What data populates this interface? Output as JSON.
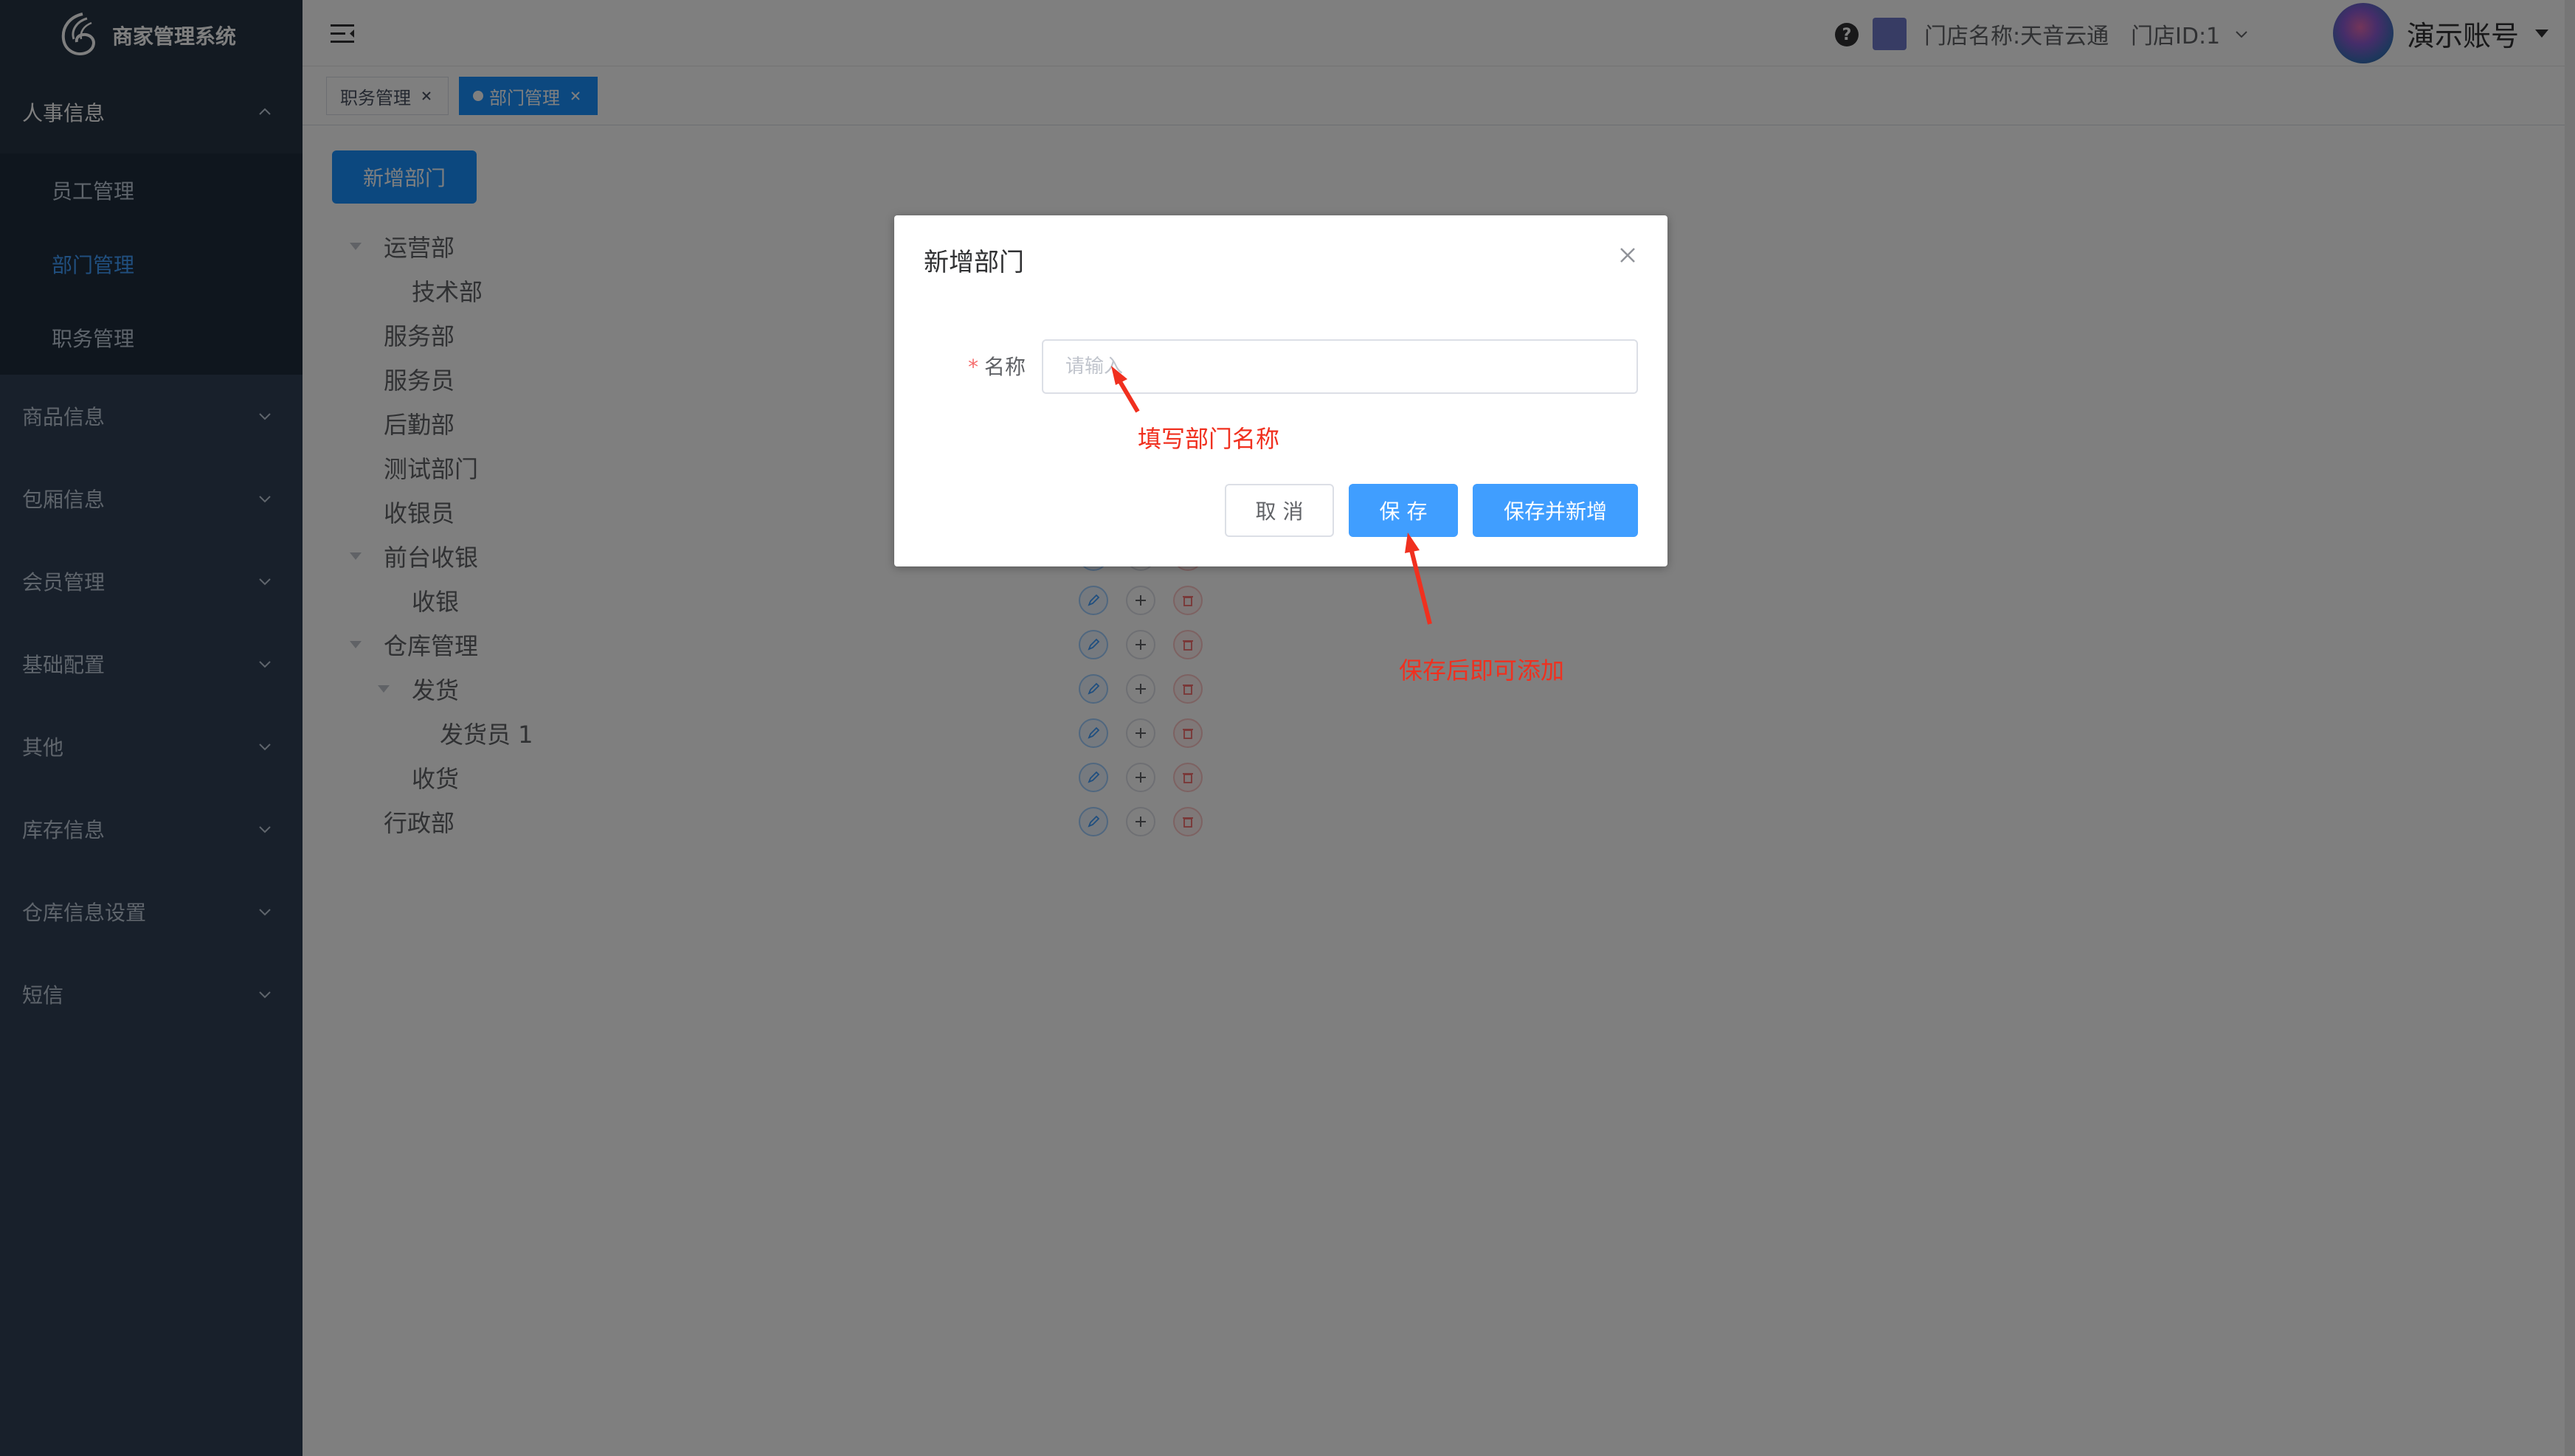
{
  "app": {
    "title": "商家管理系统"
  },
  "sidebar": {
    "groups": [
      {
        "label": "人事信息",
        "open": true
      },
      {
        "label": "商品信息"
      },
      {
        "label": "包厢信息"
      },
      {
        "label": "会员管理"
      },
      {
        "label": "基础配置"
      },
      {
        "label": "其他"
      },
      {
        "label": "库存信息"
      },
      {
        "label": "仓库信息设置"
      },
      {
        "label": "短信"
      }
    ],
    "submenu": [
      {
        "label": "员工管理"
      },
      {
        "label": "部门管理",
        "active": true
      },
      {
        "label": "职务管理"
      }
    ]
  },
  "header": {
    "store_name": "门店名称:天音云通",
    "store_id": "门店ID:1",
    "account": "演示账号"
  },
  "tags": [
    {
      "label": "职务管理"
    },
    {
      "label": "部门管理",
      "active": true
    }
  ],
  "main": {
    "add_button": "新增部门",
    "tree": [
      {
        "label": "运营部",
        "level": 0,
        "expanded": true
      },
      {
        "label": "技术部",
        "level": 1
      },
      {
        "label": "服务部",
        "level": 0
      },
      {
        "label": "服务员",
        "level": 0
      },
      {
        "label": "后勤部",
        "level": 0
      },
      {
        "label": "测试部门",
        "level": 0
      },
      {
        "label": "收银员",
        "level": 0
      },
      {
        "label": "前台收银",
        "level": 0,
        "expanded": true
      },
      {
        "label": "收银",
        "level": 1
      },
      {
        "label": "仓库管理",
        "level": 0,
        "expanded": true
      },
      {
        "label": "发货",
        "level": 1,
        "expanded": true
      },
      {
        "label": "发货员 1",
        "level": 2
      },
      {
        "label": "收货",
        "level": 1
      },
      {
        "label": "行政部",
        "level": 0
      }
    ]
  },
  "dialog": {
    "title": "新增部门",
    "field_label": "名称",
    "field_value": "",
    "field_placeholder": "请输入",
    "cancel": "取 消",
    "save": "保 存",
    "save_and_add": "保存并新增"
  },
  "annotations": {
    "name_hint": "填写部门名称",
    "save_hint": "保存后即可添加"
  },
  "colors": {
    "sidebar_bg": "#304156",
    "primary": "#409eff",
    "annotation": "#f0301f"
  }
}
